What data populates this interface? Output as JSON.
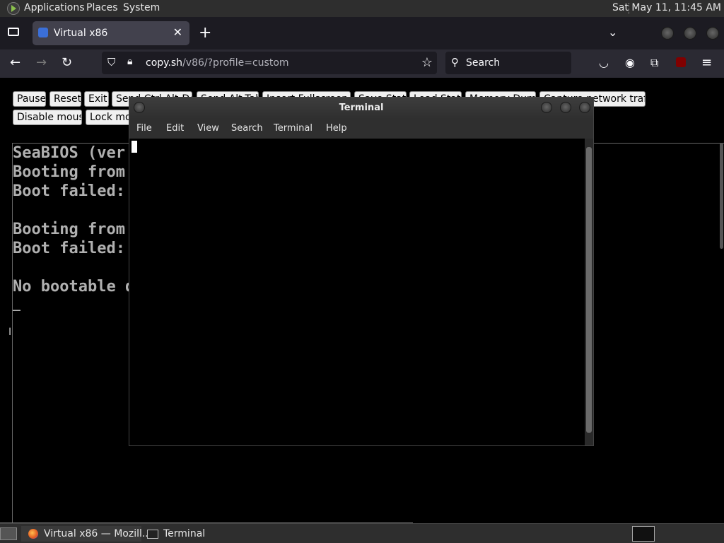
{
  "top_panel": {
    "menus": [
      "Applications",
      "Places",
      "System"
    ],
    "clock": "Sat May 11, 11:45 AM"
  },
  "browser": {
    "tab_title": "Virtual x86",
    "url_host": "copy.sh",
    "url_path": "/v86/?profile=custom",
    "search_placeholder": "Search"
  },
  "page": {
    "buttons_row1": [
      "Pause",
      "Reset",
      "Exit",
      "Send Ctrl-Alt-Del",
      "Send Alt-Tab",
      "Insert Fullscreen",
      "Save State",
      "Load State",
      "Memory Dump",
      "Capture network traffic"
    ],
    "buttons_row2": [
      "Disable mouse",
      "Lock mouse"
    ],
    "bios_lines": [
      "SeaBIOS (ver",
      "Booting from",
      "Boot failed:",
      "",
      "Booting from",
      "Boot failed:",
      "",
      "No bootable d"
    ]
  },
  "terminal": {
    "title": "Terminal",
    "menus": [
      "File",
      "Edit",
      "View",
      "Search",
      "Terminal",
      "Help"
    ]
  },
  "taskbar": {
    "tasks": [
      "Virtual x86 — Mozill...",
      "Terminal"
    ]
  },
  "colors": {
    "panel_bg": "#2e2e2e",
    "browser_bg": "#2b2a33",
    "accent": "#3b6fd8"
  }
}
